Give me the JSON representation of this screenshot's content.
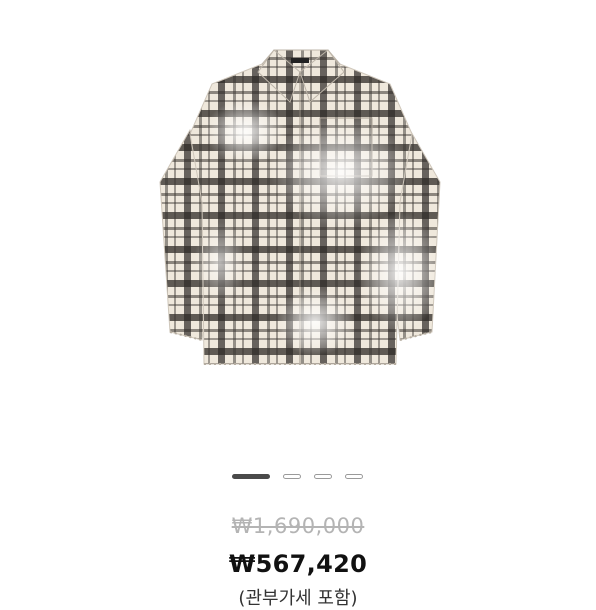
{
  "product": {
    "image_alt": "plaid-shirt",
    "price": {
      "original": "₩1,690,000",
      "sale": "₩567,420",
      "tax_note": "(관부가세 포함)"
    }
  },
  "carousel": {
    "total": 4,
    "active_index": 0
  },
  "colors": {
    "text_strong": "#111111",
    "text_muted": "#b4b4b4",
    "dot_active": "#4a4a4a",
    "dot_inactive": "#9a9a9a"
  }
}
